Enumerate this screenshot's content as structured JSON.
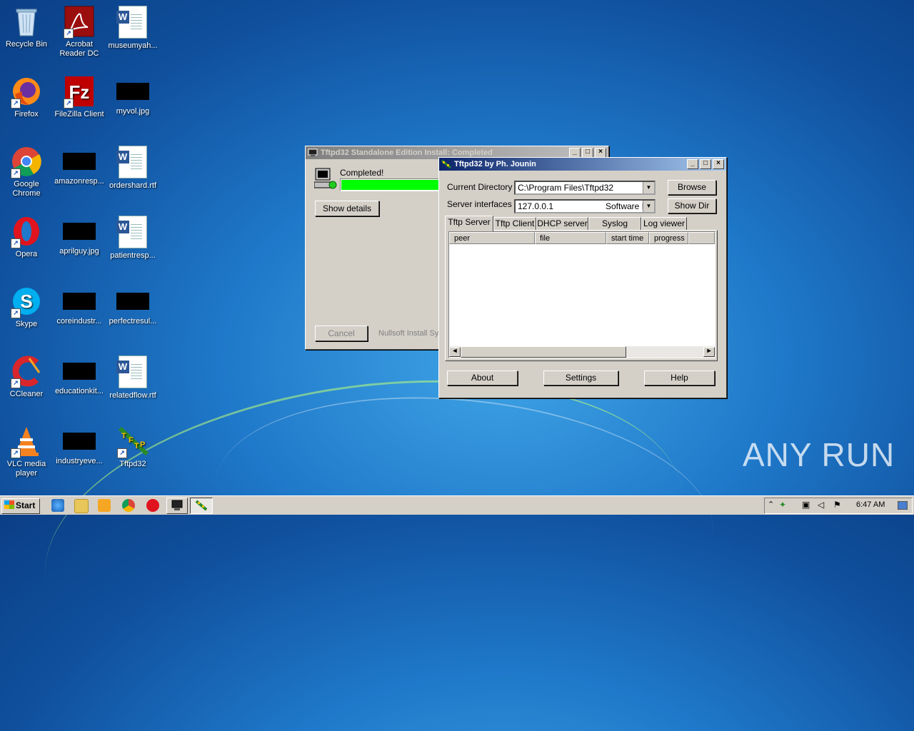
{
  "desktop": {
    "icons": [
      {
        "label": "Recycle Bin"
      },
      {
        "label": "Acrobat Reader DC"
      },
      {
        "label": "museumyah..."
      },
      {
        "label": "Firefox"
      },
      {
        "label": "FileZilla Client"
      },
      {
        "label": "myvol.jpg"
      },
      {
        "label": "Google Chrome"
      },
      {
        "label": "amazonresp..."
      },
      {
        "label": "ordershard.rtf"
      },
      {
        "label": "Opera"
      },
      {
        "label": "aprilguy.jpg"
      },
      {
        "label": "patientresp..."
      },
      {
        "label": "Skype"
      },
      {
        "label": "coreindustr..."
      },
      {
        "label": "perfectresul..."
      },
      {
        "label": "CCleaner"
      },
      {
        "label": "educationkit..."
      },
      {
        "label": "relatedflow.rtf"
      },
      {
        "label": "VLC media player"
      },
      {
        "label": "industryeve..."
      },
      {
        "label": "Tftpd32"
      }
    ]
  },
  "installer": {
    "title": "Tftpd32 Standalone Edition Install: Completed",
    "status": "Completed!",
    "progress": 1.0,
    "show_details": "Show details",
    "cancel": "Cancel",
    "brand": "Nullsoft Install Sy"
  },
  "tftpd": {
    "title": "Tftpd32 by Ph. Jounin",
    "current_dir_label": "Current Directory",
    "current_dir_value": "C:\\Program Files\\Tftpd32",
    "server_if_label": "Server interfaces",
    "server_if_value": "127.0.0.1",
    "server_if_desc": "Software Lo",
    "browse": "Browse",
    "show_dir": "Show Dir",
    "tabs": [
      "Tftp Server",
      "Tftp Client",
      "DHCP server",
      "Syslog server",
      "Log viewer"
    ],
    "columns": [
      "peer",
      "file",
      "start time",
      "progress"
    ],
    "about": "About",
    "settings": "Settings",
    "help": "Help"
  },
  "taskbar": {
    "start": "Start",
    "clock": "6:47 AM"
  },
  "watermark": "ANY RUN"
}
